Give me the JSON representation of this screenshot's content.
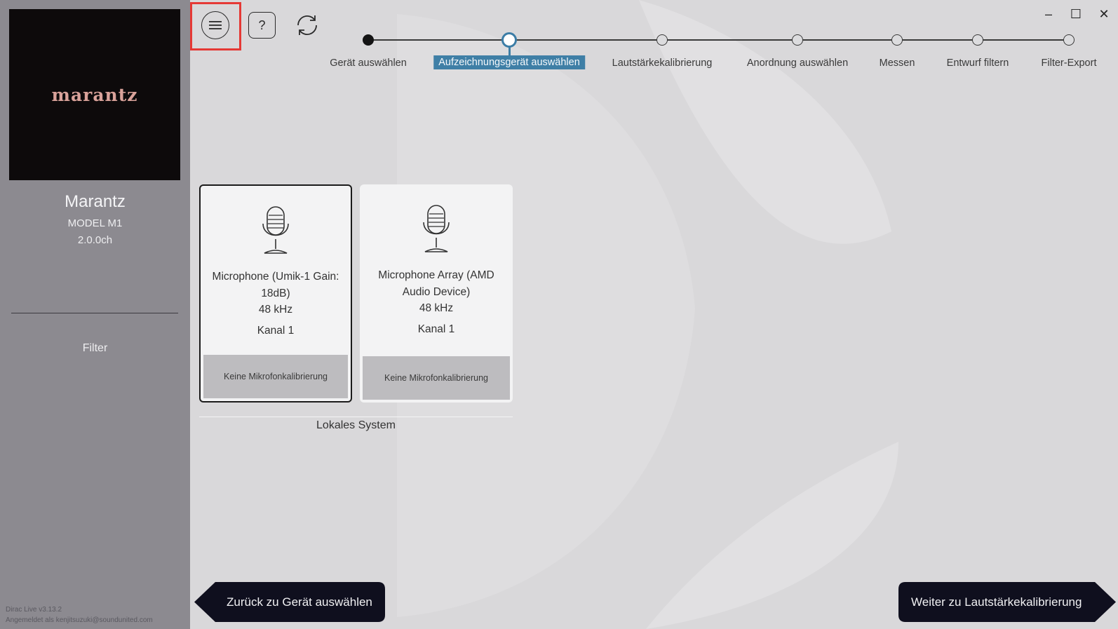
{
  "sidebar": {
    "logo_text": "marantz",
    "device_name": "Marantz",
    "device_model": "MODEL M1",
    "device_channels": "2.0.0ch",
    "filter_label": "Filter",
    "version": "Dirac Live v3.13.2",
    "login": "Angemeldet als kenjitsuzuki@soundunited.com"
  },
  "toolbar": {
    "help_label": "?"
  },
  "window_controls": {
    "minimize": "–",
    "maximize": "☐",
    "close": "✕"
  },
  "stepper": {
    "steps": [
      {
        "label": "Gerät auswählen",
        "state": "done"
      },
      {
        "label": "Aufzeichnungsgerät auswählen",
        "state": "active"
      },
      {
        "label": "Lautstärkekalibrierung",
        "state": "pending"
      },
      {
        "label": "Anordnung auswählen",
        "state": "pending"
      },
      {
        "label": "Messen",
        "state": "pending"
      },
      {
        "label": "Entwurf filtern",
        "state": "pending"
      },
      {
        "label": "Filter-Export",
        "state": "pending"
      }
    ]
  },
  "devices": [
    {
      "name": "Microphone (Umik-1  Gain: 18dB)",
      "sample_rate": "48 kHz",
      "channel": "Kanal 1",
      "calibration": "Keine Mikrofonkalibrierung",
      "selected": true
    },
    {
      "name": "Microphone Array (AMD Audio Device)",
      "sample_rate": "48 kHz",
      "channel": "Kanal 1",
      "calibration": "Keine Mikrofonkalibrierung",
      "selected": false
    }
  ],
  "group_label": "Lokales System",
  "navigation": {
    "back_label": "Zurück zu Gerät auswählen",
    "next_label": "Weiter zu Lautstärkekalibrierung"
  },
  "colors": {
    "accent": "#3f7fa6",
    "sidebar": "#8c8a90",
    "background": "#d9d8da",
    "nav_button": "#0f0f1e",
    "highlight": "#e53935"
  }
}
